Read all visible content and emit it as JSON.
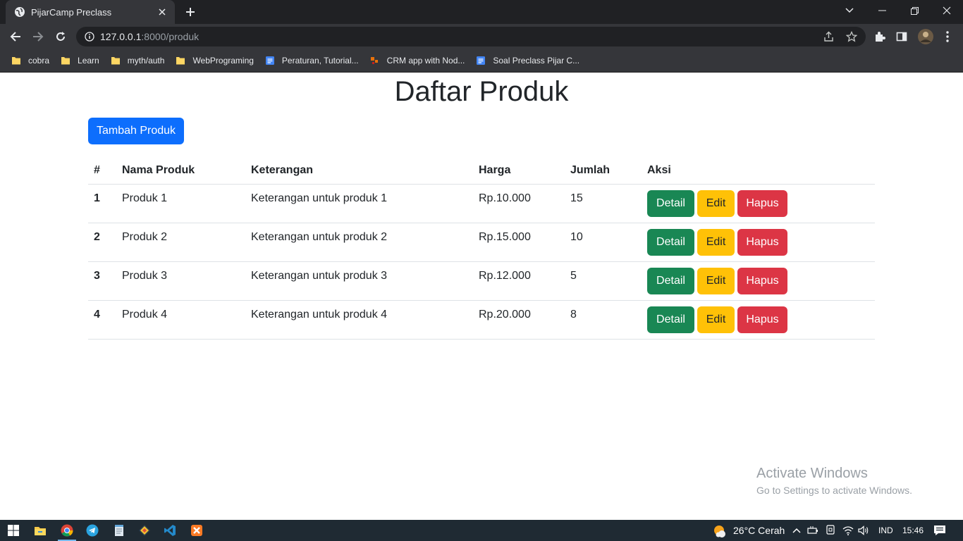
{
  "browser": {
    "tab_title": "PijarCamp Preclass",
    "url_host": "127.0.0.1",
    "url_path": ":8000/produk",
    "bookmarks": [
      {
        "label": "cobra",
        "icon": "folder-icon"
      },
      {
        "label": "Learn",
        "icon": "folder-icon"
      },
      {
        "label": "myth/auth",
        "icon": "folder-icon"
      },
      {
        "label": "WebPrograming",
        "icon": "folder-icon"
      },
      {
        "label": "Peraturan, Tutorial...",
        "icon": "doc-icon"
      },
      {
        "label": "CRM app with Nod...",
        "icon": "puzzle-site-icon"
      },
      {
        "label": "Soal Preclass Pijar C...",
        "icon": "doc-icon"
      }
    ]
  },
  "page": {
    "title": "Daftar Produk",
    "add_button": "Tambah Produk",
    "table": {
      "headers": [
        "#",
        "Nama Produk",
        "Keterangan",
        "Harga",
        "Jumlah",
        "Aksi"
      ],
      "rows": [
        {
          "no": "1",
          "nama": "Produk 1",
          "keterangan": "Keterangan untuk produk 1",
          "harga": "Rp.10.000",
          "jumlah": "15"
        },
        {
          "no": "2",
          "nama": "Produk 2",
          "keterangan": "Keterangan untuk produk 2",
          "harga": "Rp.15.000",
          "jumlah": "10"
        },
        {
          "no": "3",
          "nama": "Produk 3",
          "keterangan": "Keterangan untuk produk 3",
          "harga": "Rp.12.000",
          "jumlah": "5"
        },
        {
          "no": "4",
          "nama": "Produk 4",
          "keterangan": "Keterangan untuk produk 4",
          "harga": "Rp.20.000",
          "jumlah": "8"
        }
      ],
      "actions": {
        "detail": "Detail",
        "edit": "Edit",
        "hapus": "Hapus"
      }
    }
  },
  "watermark": {
    "title": "Activate Windows",
    "subtitle": "Go to Settings to activate Windows."
  },
  "taskbar": {
    "weather": "26°C  Cerah",
    "language": "IND",
    "time": "15:46"
  },
  "colors": {
    "primary": "#0d6efd",
    "success": "#198754",
    "warning": "#ffc107",
    "danger": "#dc3545"
  }
}
